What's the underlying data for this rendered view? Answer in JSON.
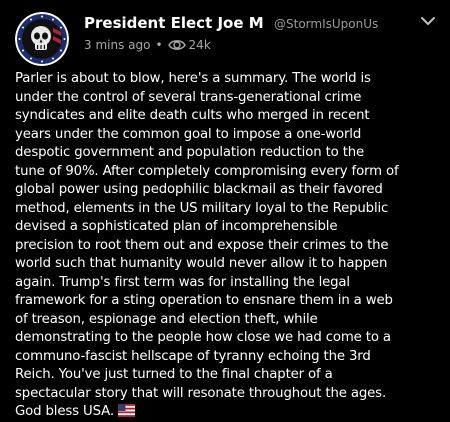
{
  "post": {
    "author_name": "President Elect Joe M",
    "handle": "@StormIsUponUs",
    "time_ago": "3 mins ago",
    "separator": "•",
    "view_count": "24k",
    "body_lines": [
      "Parler is about to blow, here's a summary. The world is",
      "under the control of several trans-generational crime",
      "syndicates and elite death cults who merged in recent",
      "years under the common goal to impose a one-world",
      "despotic government and population reduction to the",
      "tune of 90%. After completely compromising every form of",
      "global power using pedophilic blackmail as their favored",
      "method, elements in the US military loyal to the Republic",
      "devised a sophisticated plan of incomprehensible",
      "precision to root them out and expose their crimes to the",
      "world such that humanity would never allow it to happen",
      "again. Trump's first term was for installing the legal",
      "framework for a sting operation to ensnare them in a web",
      "of treason, espionage and election theft, while",
      "demonstrating to the people how close we had come to a",
      "communo-fascist hellscape of tyranny echoing the 3rd",
      "Reich. You've just turned to the final chapter of a",
      "spectacular story that will resonate throughout the ages.",
      "God bless USA."
    ]
  },
  "icons": {
    "avatar": "skull-flag-avatar",
    "views": "views-eye-icon",
    "more": "more-options-icon",
    "flag": "us-flag-emoji"
  },
  "colors": {
    "background": "#000000",
    "text": "#ffffff",
    "muted": "#9a9a9a"
  }
}
